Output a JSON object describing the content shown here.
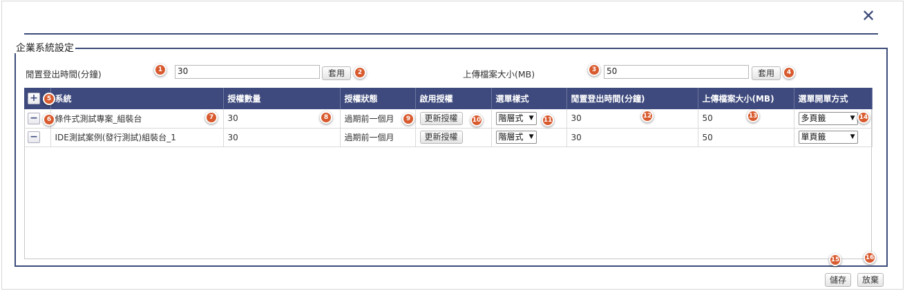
{
  "dialog": {
    "close_glyph": "✕",
    "section_title": "企業系統設定"
  },
  "settings": {
    "idle_logout": {
      "label": "閒置登出時間(分鐘)",
      "value": "30",
      "apply_label": "套用"
    },
    "upload_size": {
      "label": "上傳檔案大小(MB)",
      "value": "50",
      "apply_label": "套用"
    }
  },
  "table": {
    "add_glyph": "+",
    "remove_glyph": "−",
    "headers": [
      "系統",
      "授權數量",
      "授權狀態",
      "啟用授權",
      "選單樣式",
      "閒置登出時間(分鐘)",
      "上傳檔案大小(MB)",
      "選單開單方式"
    ],
    "rows": [
      {
        "system": "條件式測試專案_組裝台",
        "license_count": "30",
        "license_status": "過期前一個月",
        "activate_label": "更新授權",
        "menu_style": "階層式",
        "idle_minutes": "30",
        "upload_mb": "50",
        "open_mode": "多頁籤"
      },
      {
        "system": "IDE測試案例(發行測試)組裝台_1",
        "license_count": "30",
        "license_status": "過期前一個月",
        "activate_label": "更新授權",
        "menu_style": "階層式",
        "idle_minutes": "30",
        "upload_mb": "50",
        "open_mode": "單頁籤"
      }
    ]
  },
  "footer": {
    "save_label": "儲存",
    "discard_label": "放棄"
  },
  "badges": [
    "1",
    "2",
    "3",
    "4",
    "5",
    "6",
    "7",
    "8",
    "9",
    "10",
    "11",
    "12",
    "13",
    "14",
    "15",
    "16"
  ],
  "colors": {
    "header_bg": "#3e4a7d",
    "badge": "#d85a2e",
    "frame": "#3b4a78"
  }
}
